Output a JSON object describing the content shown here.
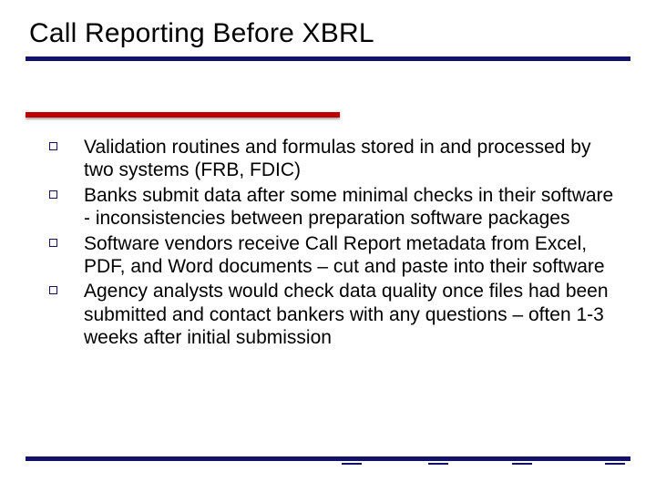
{
  "title": "Call Reporting Before XBRL",
  "bullets": [
    "Validation routines and formulas stored in and processed by two systems (FRB, FDIC)",
    "Banks submit data after some minimal checks in their software - inconsistencies between preparation software packages",
    "Software vendors receive Call Report metadata from Excel, PDF, and Word documents – cut and paste into their software",
    "Agency analysts would check data quality once files had been submitted and contact bankers with any questions – often 1-3 weeks after initial submission"
  ]
}
